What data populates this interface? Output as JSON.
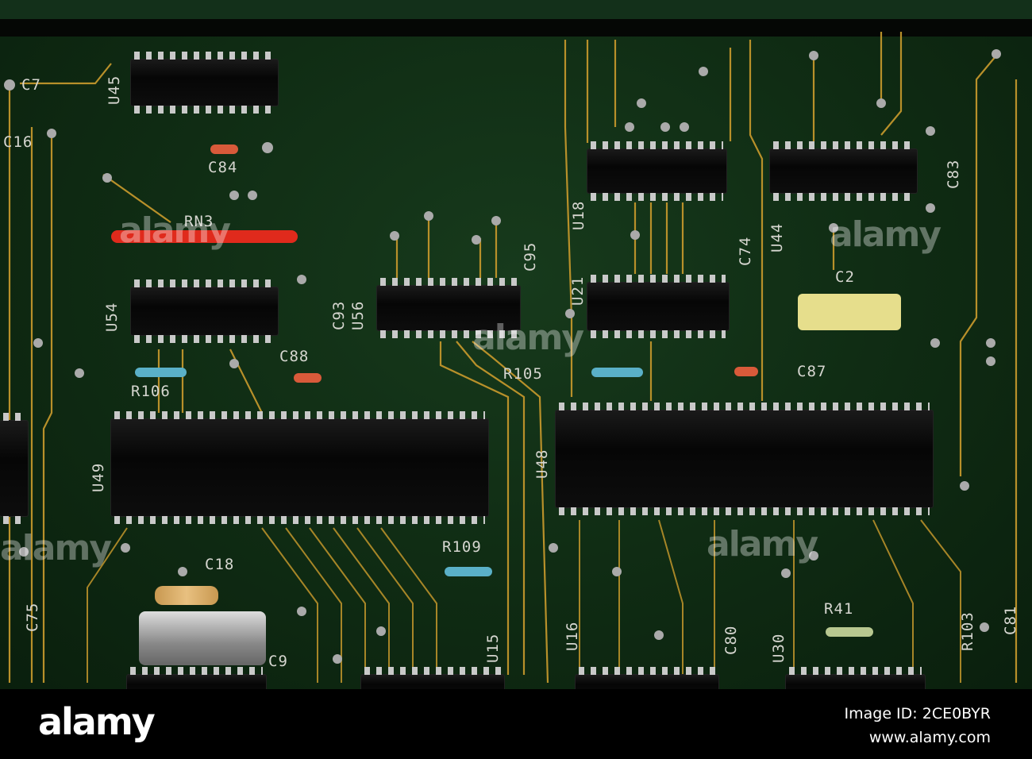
{
  "photo": {
    "subject": "",
    "labels": [
      "C7",
      "U45",
      "C16",
      "C84",
      "RN3",
      "U54",
      "C93",
      "U56",
      "C95",
      "U21",
      "U18",
      "C74",
      "U44",
      "C83",
      "C2",
      "C88",
      "R106",
      "R105",
      "C87",
      "U49",
      "U48",
      "R109",
      "C18",
      "C75",
      "C9",
      "U15",
      "U16",
      "C80",
      "U30",
      "R41",
      "R103",
      "C81"
    ],
    "colors": {
      "board": "#0f2b13",
      "trace": "#b8902a",
      "chip": "#0a0a0a",
      "pin": "#c9c9c9"
    }
  },
  "watermark": {
    "text": "alamy"
  },
  "footer": {
    "logo": "alamy",
    "image_id": "Image ID: 2CE0BYR",
    "site": "www.alamy.com"
  }
}
